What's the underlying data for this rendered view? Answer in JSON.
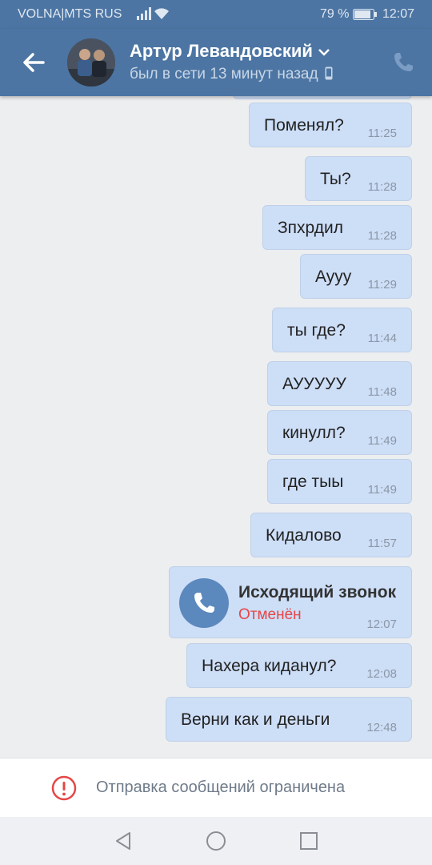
{
  "status_bar": {
    "carrier": "VOLNA|MTS RUS",
    "battery": "79 %",
    "time": "12:07"
  },
  "header": {
    "name": "Артур Левандовский",
    "last_seen": "был в сети 13 минут назад"
  },
  "messages": [
    {
      "text": "Поменял?",
      "time": "11:25"
    },
    {
      "text": "Ты?",
      "time": "11:28"
    },
    {
      "text": "Зпхрдил",
      "time": "11:28"
    },
    {
      "text": "Аууу",
      "time": "11:29"
    },
    {
      "text": "ты где?",
      "time": "11:44"
    },
    {
      "text": "АУУУУУ",
      "time": "11:48"
    },
    {
      "text": "кинулл?",
      "time": "11:49"
    },
    {
      "text": "где тыы",
      "time": "11:49"
    },
    {
      "text": "Кидалово",
      "time": "11:57"
    },
    {
      "text": "Нахера киданул?",
      "time": "12:08"
    },
    {
      "text": "Верни как и деньги",
      "time": "12:48"
    }
  ],
  "call": {
    "title": "Исходящий звонок",
    "status": "Отменён",
    "time": "12:07"
  },
  "footer": {
    "notice": "Отправка сообщений ограничена"
  },
  "colors": {
    "header": "#4c75a3",
    "bubble": "#cddef7",
    "call_icon": "#5b88bd",
    "cancelled": "#e64646",
    "warning": "#e64646"
  }
}
